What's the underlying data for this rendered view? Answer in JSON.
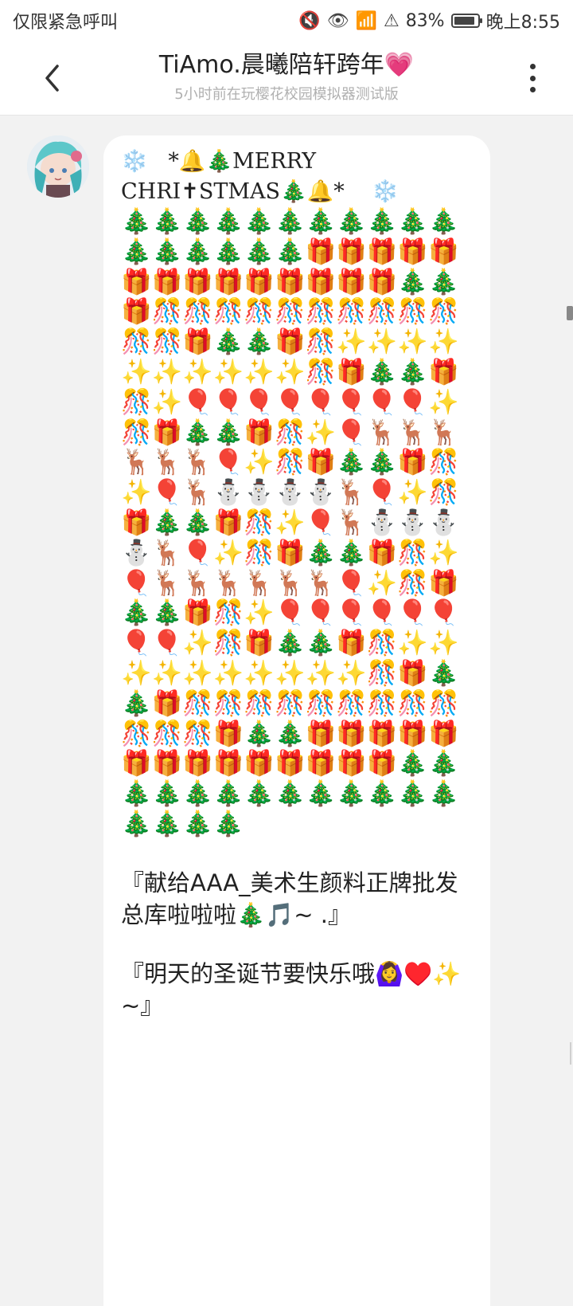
{
  "status": {
    "left": "仅限紧急呼叫",
    "battery_percent": "83%",
    "time": "晚上8:55",
    "icons": [
      "mute-icon",
      "eye-icon",
      "wifi-icon",
      "alert-icon",
      "battery-icon"
    ]
  },
  "header": {
    "title": "TiAmo.晨曦陪轩跨年💗",
    "subtitle": "5小时前在玩樱花校园模拟器测试版"
  },
  "post": {
    "line1": "❄️   *🔔🎄MERRY",
    "line2": "CHRI✝︎STMAS🎄🔔*    ❄️",
    "emoji_art": "🎄🎄🎄🎄🎄🎄🎄🎄🎄🎄🎄🎄🎄🎄🎄🎄🎄🎁🎁🎁🎁🎁🎁🎁🎁🎁🎁🎁🎁🎁🎁🎄🎄🎁🎊🎊🎊🎊🎊🎊🎊🎊🎊🎊🎊🎊🎁🎄🎄🎁🎊✨✨✨✨✨✨✨✨✨✨🎊🎁🎄🎄🎁🎊✨🎈🎈🎈🎈🎈🎈🎈🎈✨🎊🎁🎄🎄🎁🎊✨🎈🦌🦌🦌🦌🦌🦌🎈✨🎊🎁🎄🎄🎁🎊✨🎈🦌⛄⛄⛄⛄🦌🎈✨🎊🎁🎄🎄🎁🎊✨🎈🦌⛄⛄⛄⛄🦌🎈✨🎊🎁🎄🎄🎁🎊✨🎈🦌🦌🦌🦌🦌🦌🎈✨🎊🎁🎄🎄🎁🎊✨🎈🎈🎈🎈🎈🎈🎈🎈✨🎊🎁🎄🎄🎁🎊✨✨✨✨✨✨✨✨✨✨🎊🎁🎄🎄🎁🎊🎊🎊🎊🎊🎊🎊🎊🎊🎊🎊🎊🎁🎄🎄🎁🎁🎁🎁🎁🎁🎁🎁🎁🎁🎁🎁🎁🎁🎄🎄🎄🎄🎄🎄🎄🎄🎄🎄🎄🎄🎄🎄🎄🎄🎄",
    "message1": "『献给AAA_美术生颜料正牌批发总库啦啦啦🎄🎵~ .』",
    "message2": "『明天的圣诞节要快乐哦🙆‍♀️♥️✨~』"
  }
}
